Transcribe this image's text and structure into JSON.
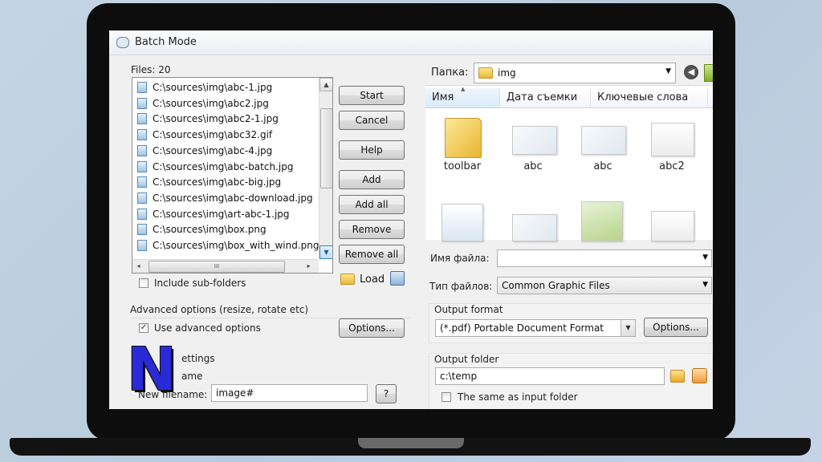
{
  "window": {
    "title": "Batch Mode"
  },
  "files": {
    "count_label": "Files: 20",
    "items": [
      "C:\\sources\\img\\abc-1.jpg",
      "C:\\sources\\img\\abc2.jpg",
      "C:\\sources\\img\\abc2-1.jpg",
      "C:\\sources\\img\\abc32.gif",
      "C:\\sources\\img\\abc-4.jpg",
      "C:\\sources\\img\\abc-batch.jpg",
      "C:\\sources\\img\\abc-big.jpg",
      "C:\\sources\\img\\abc-download.jpg",
      "C:\\sources\\img\\art-abc-1.jpg",
      "C:\\sources\\img\\box.png",
      "C:\\sources\\img\\box_with_wind.png"
    ],
    "hscroll_grip": "III",
    "include_subfolders_label": "Include sub-folders"
  },
  "actions": {
    "start": "Start",
    "cancel": "Cancel",
    "help": "Help",
    "add": "Add",
    "add_all": "Add all",
    "remove": "Remove",
    "remove_all": "Remove all",
    "load": "Load"
  },
  "advanced": {
    "heading": "Advanced options (resize, rotate etc)",
    "use_label": "Use advanced options",
    "use_checked": true,
    "options_button": "Options..."
  },
  "rename": {
    "heading_partial": "ettings",
    "name_partial": "ame",
    "new_filename_label": "New filename:",
    "new_filename_value": "image#",
    "help_button": "?"
  },
  "explorer": {
    "folder_label": "Папка:",
    "folder_value": "img",
    "columns": [
      "Имя",
      "Дата съемки",
      "Ключевые слова"
    ],
    "thumbnails": [
      {
        "label": "toolbar"
      },
      {
        "label": "abc"
      },
      {
        "label": "abc"
      },
      {
        "label": "abc2"
      },
      {
        "label": ""
      },
      {
        "label": ""
      },
      {
        "label": ""
      },
      {
        "label": ""
      }
    ],
    "filename_label": "Имя файла:",
    "filename_value": "",
    "filetype_label": "Тип файлов:",
    "filetype_value": "Common Graphic Files"
  },
  "output": {
    "format_heading": "Output format",
    "format_value": "(*.pdf) Portable Document Format",
    "options_button": "Options...",
    "folder_heading": "Output folder",
    "folder_value": "c:\\temp",
    "same_as_input_label": "The same as input folder"
  },
  "logo": {
    "letter": "N",
    "color": "#2a2bd6"
  }
}
